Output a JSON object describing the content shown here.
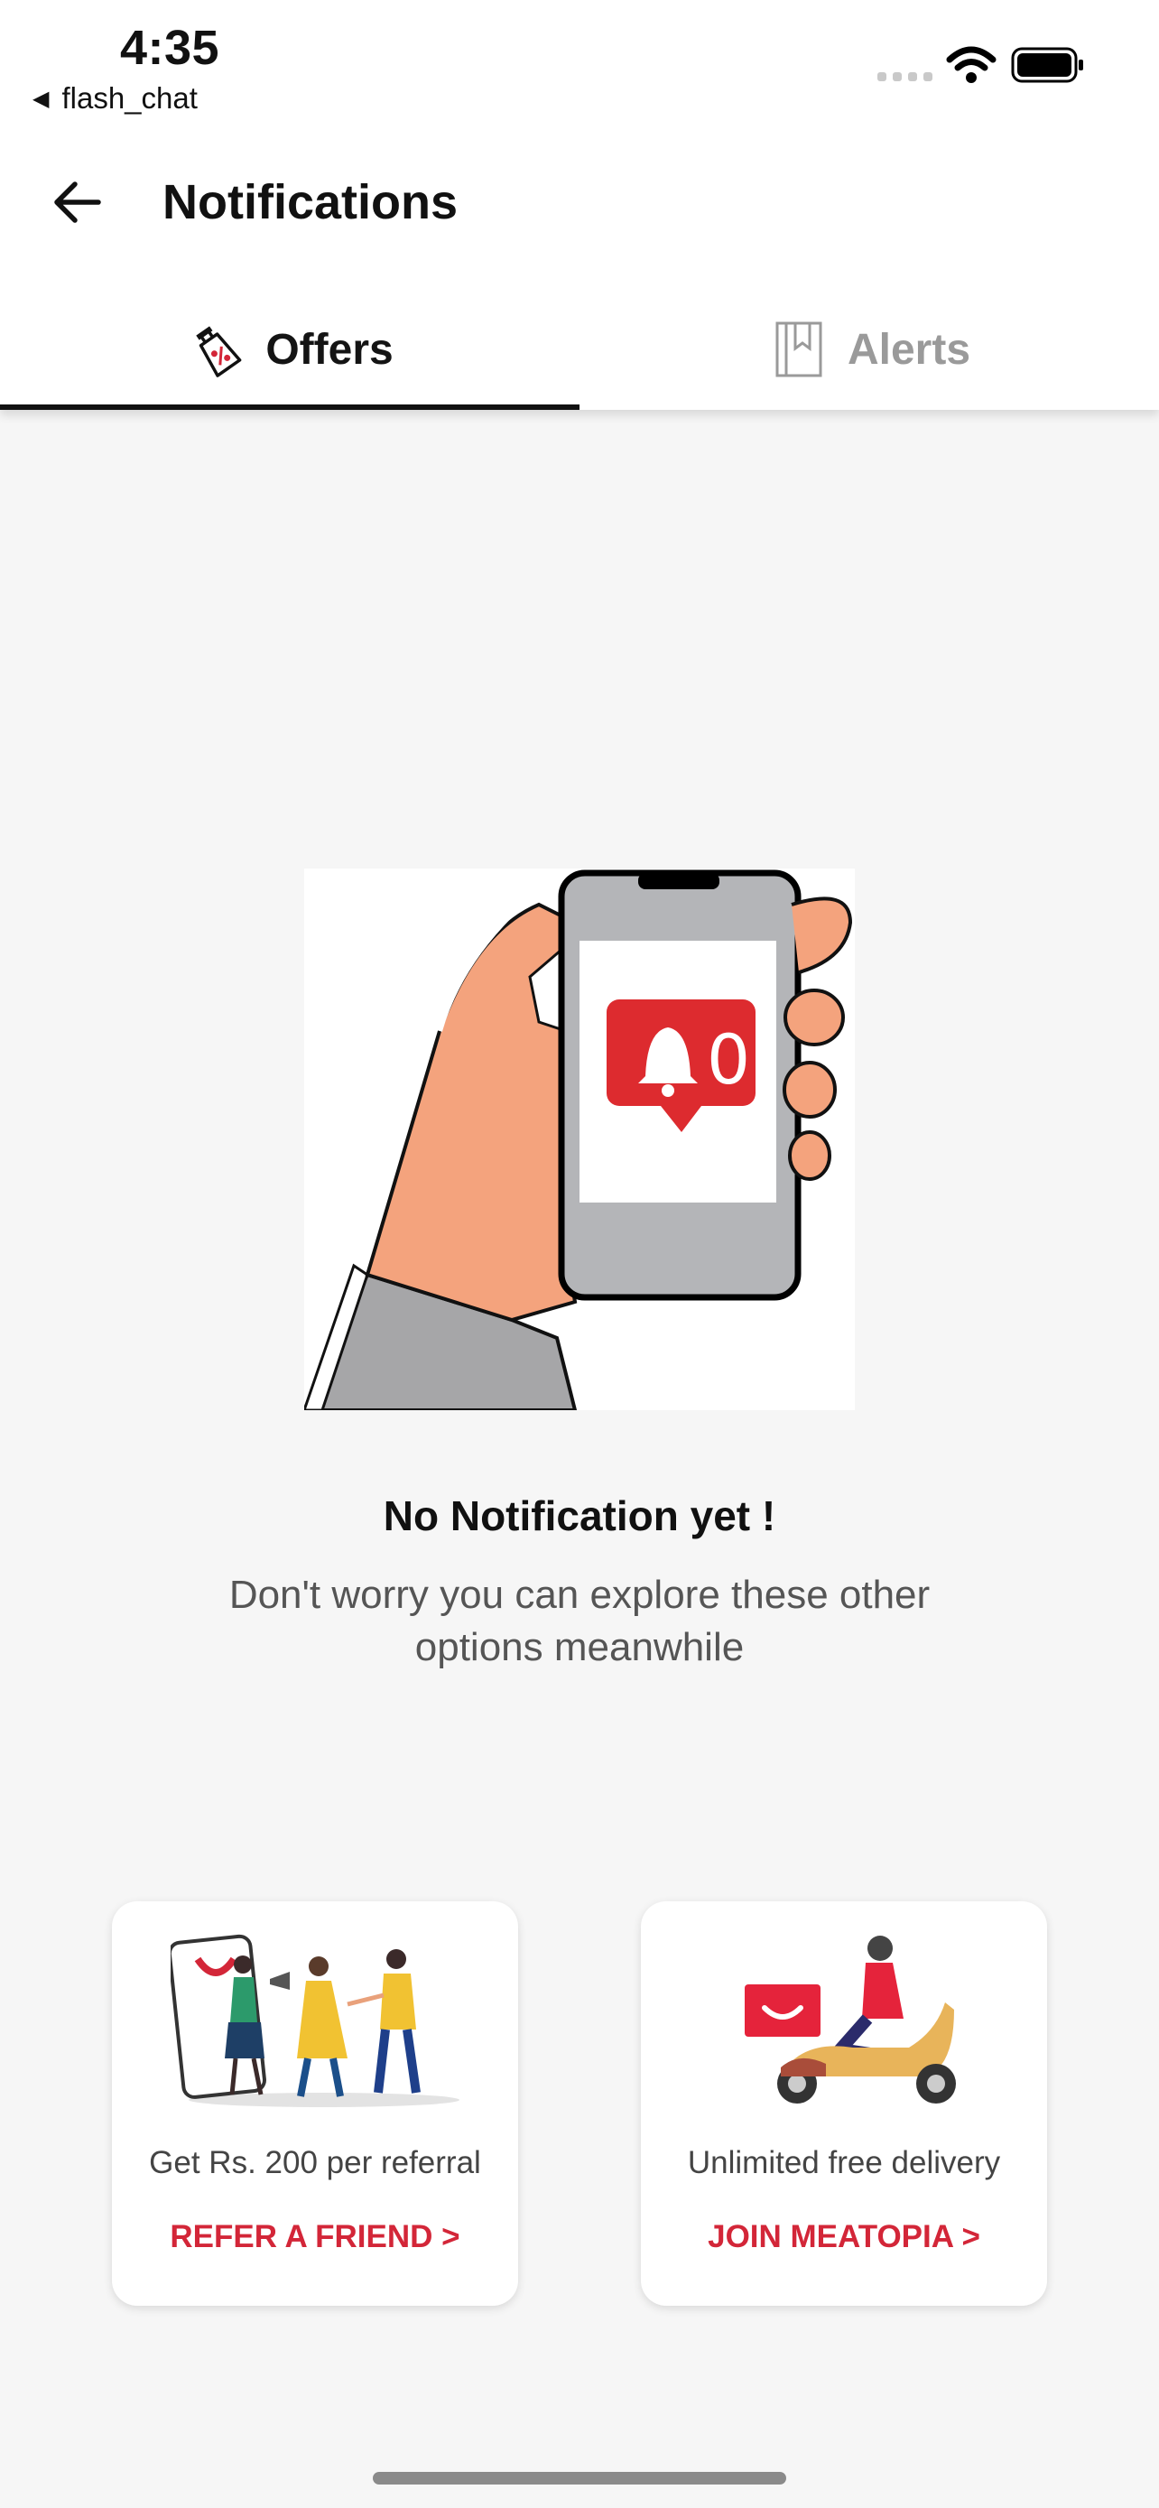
{
  "status_bar": {
    "time": "4:35",
    "back_app": "flash_chat"
  },
  "header": {
    "title": "Notifications"
  },
  "tabs": [
    {
      "label": "Offers",
      "icon": "offer-tag-icon",
      "active": true
    },
    {
      "label": "Alerts",
      "icon": "bookmark-icon",
      "active": false
    }
  ],
  "empty_state": {
    "title": "No Notification yet !",
    "subtitle": "Don't worry you can explore these other options meanwhile",
    "badge_count": "0"
  },
  "cards": [
    {
      "description": "Get Rs. 200 per referral",
      "cta": "REFER A FRIEND >",
      "illustration": "refer-friends-illustration"
    },
    {
      "description": "Unlimited free delivery",
      "cta": "JOIN MEATOPIA >",
      "illustration": "delivery-scooter-illustration"
    }
  ],
  "colors": {
    "accent_red": "#d32638",
    "background": "#f6f6f6",
    "active_tab": "#141414",
    "inactive_tab": "#9a9a9a"
  }
}
